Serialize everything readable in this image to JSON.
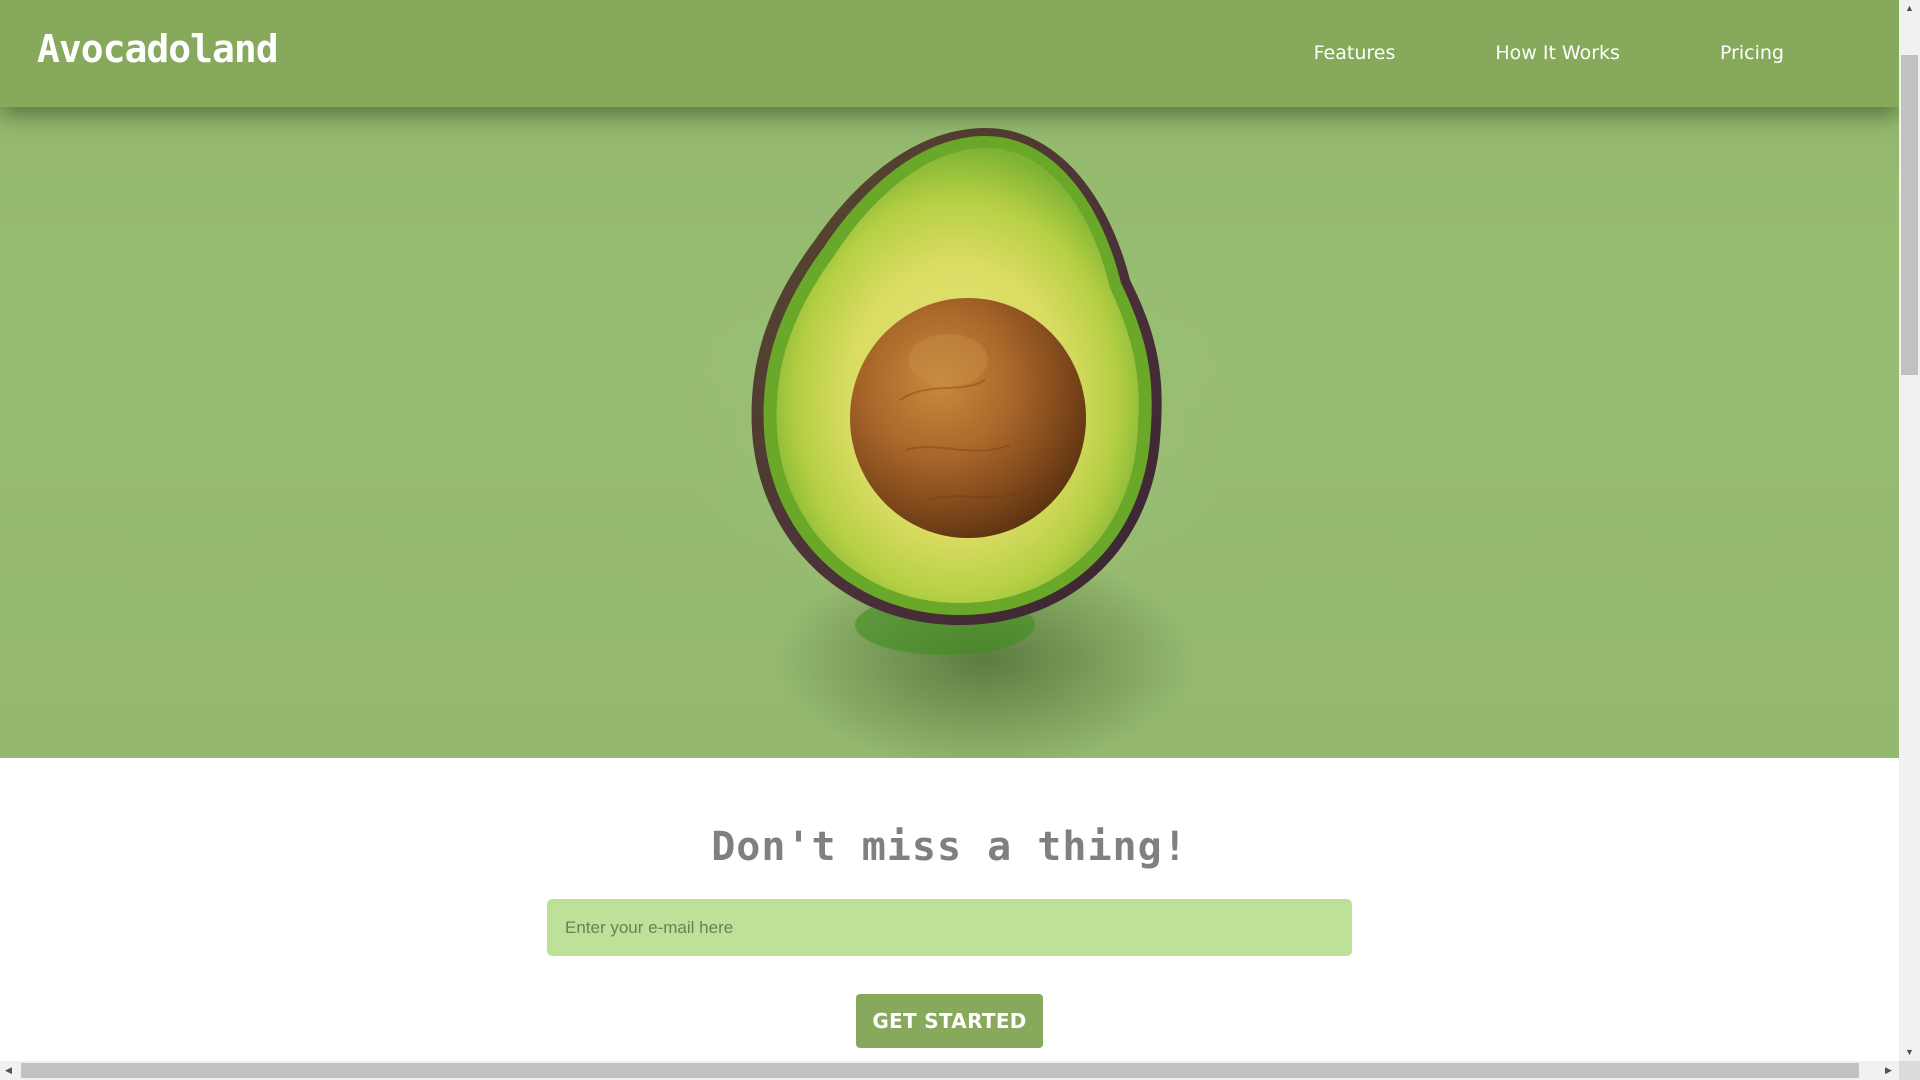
{
  "header": {
    "brand": "Avocadoland",
    "nav": [
      {
        "label": "Features"
      },
      {
        "label": "How It Works"
      },
      {
        "label": "Pricing"
      }
    ]
  },
  "hero": {
    "image_subject": "avocado-half-with-pit",
    "background_color": "#96bb70"
  },
  "signup": {
    "title": "Don't miss a thing!",
    "email_placeholder": "Enter your e-mail here",
    "button_label": "GET STARTED"
  },
  "colors": {
    "accent": "#86a95c",
    "input_bg": "#bde196",
    "title_gray": "#808080"
  },
  "icons": {
    "scroll_up": "scroll-up-arrow-icon",
    "scroll_down": "scroll-down-arrow-icon",
    "scroll_left": "scroll-left-arrow-icon",
    "scroll_right": "scroll-right-arrow-icon"
  }
}
